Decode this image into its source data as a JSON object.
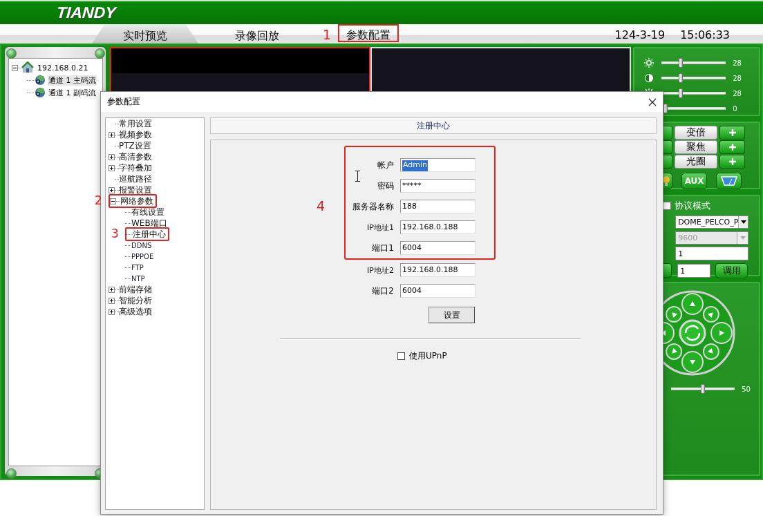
{
  "header": {
    "logo": "TIANDY"
  },
  "tabs": [
    {
      "label": "实时预览",
      "selected": true
    },
    {
      "label": "录像回放",
      "selected": false
    },
    {
      "label": "参数配置",
      "selected": false,
      "annotation": "1"
    }
  ],
  "clock": {
    "date": "124-3-19",
    "time": "15:06:33"
  },
  "device_tree": {
    "label": "192.168.0.21",
    "expanded": true,
    "children": [
      {
        "label": "通道 1 主码流",
        "selected": true
      },
      {
        "label": "通道 1 副码流",
        "selected": false
      }
    ]
  },
  "video_panes": [
    {
      "kind": "picture",
      "selected": true
    },
    {
      "kind": "picture",
      "selected": false
    }
  ],
  "image_controls": [
    {
      "kind": "brightness",
      "level": 0.3,
      "reading": "28"
    },
    {
      "kind": "contrast",
      "level": 0.3,
      "reading": "28"
    },
    {
      "kind": "saturation",
      "level": 0.3,
      "reading": "28"
    },
    {
      "kind": "hue",
      "level": 0.06,
      "reading": "0"
    }
  ],
  "lens_controls": [
    {
      "label": "变倍"
    },
    {
      "label": "聚焦"
    },
    {
      "label": "光圈"
    }
  ],
  "lens_buttons": [
    {
      "kind": "light"
    },
    {
      "kind": "aux",
      "label": "AUX"
    },
    {
      "kind": "wiper"
    }
  ],
  "protocol": {
    "checked": false,
    "label": "协议模式",
    "protocol_value": "DOME_PELCO_P",
    "baud_rate": {
      "value": "9600",
      "disabled": true
    },
    "address": "1",
    "preset": "1",
    "call_button": "调用"
  },
  "speed": {
    "level": 0.5,
    "reading": "50"
  },
  "dialog": {
    "title": "参数配置",
    "tree": [
      {
        "label": "常用设置"
      },
      {
        "label": "视频参数",
        "expanded": false
      },
      {
        "label": "PTZ设置"
      },
      {
        "label": "高清参数",
        "expanded": false
      },
      {
        "label": "字符叠加",
        "expanded": false
      },
      {
        "label": "巡航路径"
      },
      {
        "label": "报警设置",
        "expanded": false
      },
      {
        "label": "网络参数",
        "expanded": true,
        "annotation": "2",
        "children": [
          {
            "label": "有线设置"
          },
          {
            "label": "WEB端口"
          },
          {
            "label": "注册中心",
            "annotation": "3"
          },
          {
            "label": "DDNS"
          },
          {
            "label": "PPPOE"
          },
          {
            "label": "FTP"
          },
          {
            "label": "NTP"
          }
        ]
      },
      {
        "label": "前端存储",
        "expanded": false
      },
      {
        "label": "智能分析",
        "expanded": false
      },
      {
        "label": "高级选项",
        "expanded": false
      }
    ],
    "section_title": "注册中心",
    "field_groups": [
      {
        "annotation": "4",
        "fields": [
          {
            "label": "帐户",
            "value": "Admin",
            "text_selected": true
          },
          {
            "label": "密码",
            "value": "*****"
          },
          {
            "label": "服务器名称",
            "value": "188"
          },
          {
            "label": "IP地址1",
            "value": "192.168.0.188"
          },
          {
            "label": "端口1",
            "value": "6004"
          }
        ]
      },
      {
        "fields": [
          {
            "label": "IP地址2",
            "value": "192.168.0.188"
          },
          {
            "label": "端口2",
            "value": "6004"
          }
        ]
      }
    ],
    "apply_button": "设置",
    "upnp": {
      "label": "使用UPnP",
      "checked": false
    }
  }
}
